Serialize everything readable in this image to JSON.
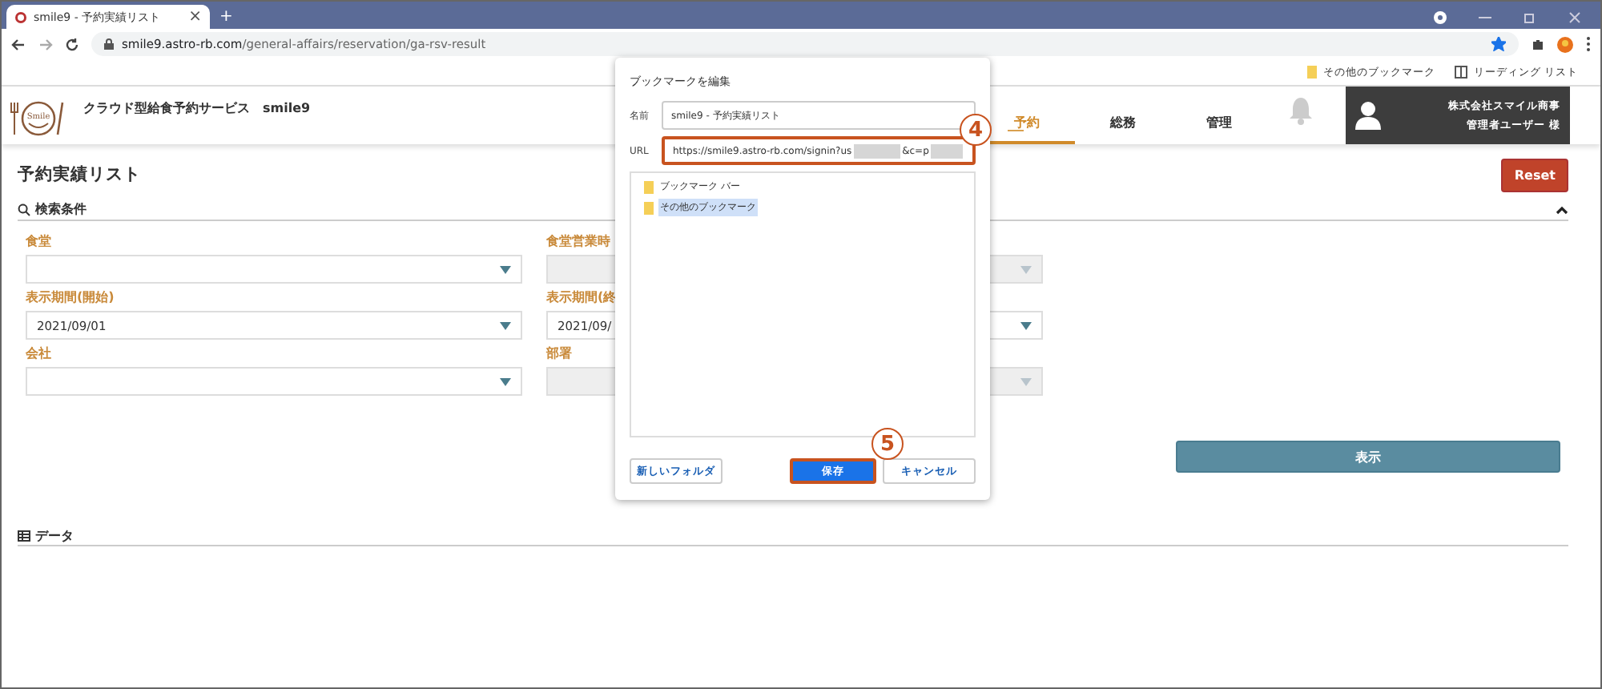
{
  "browser": {
    "tab_title": "smile9 - 予約実績リスト",
    "tab_close": "×",
    "new_tab": "+",
    "host": "smile9.astro-rb.com",
    "path": "/general-affairs/reservation/ga-rsv-result",
    "bookmarked": true,
    "bookmarks": [
      {
        "label": "その他のブックマーク",
        "kind": "folder"
      },
      {
        "label": "リーディング リスト",
        "kind": "reading"
      }
    ]
  },
  "app": {
    "logo_text": "Smile",
    "service_name": "クラウド型給食予約サービス　smile9",
    "nav": [
      {
        "label": "予約",
        "selected": true
      },
      {
        "label": "総務",
        "selected": false
      },
      {
        "label": "管理",
        "selected": false
      }
    ],
    "user": {
      "company": "株式会社スマイル商事",
      "name": "管理者ユーザー 様"
    }
  },
  "page": {
    "title": "予約実績リスト",
    "reset_button": "Reset",
    "search_title": "検索条件",
    "search_expanded": true,
    "fields": [
      {
        "label": "食堂",
        "disabled": false
      },
      {
        "label": "食堂営業時",
        "disabled": true
      },
      {
        "label": "表示期間(開始)",
        "value": "2021/09/01",
        "disabled": false
      },
      {
        "label": "表示期間(終",
        "value": "2021/09/",
        "disabled": false
      },
      {
        "label": "会社",
        "disabled": false
      },
      {
        "label": "部署",
        "disabled": true
      }
    ],
    "show_button": "表示",
    "data_title": "データ"
  },
  "dialog": {
    "title": "ブックマークを編集",
    "name_label": "名前",
    "name_value": "smile9 - 予約実績リスト",
    "url_label": "URL",
    "url_parts": [
      "https://smile9.astro-rb.com/signin?us",
      "&c=p"
    ],
    "url_annotation": "4",
    "folders": [
      {
        "label": "ブックマーク バー",
        "selected": false
      },
      {
        "label": "その他のブックマーク",
        "selected": true
      }
    ],
    "buttons": [
      {
        "label": "新しいフォルダ",
        "kind": "secondary"
      },
      {
        "label": "保存",
        "kind": "primary",
        "annotation": "5"
      },
      {
        "label": "キャンセル",
        "kind": "secondary"
      }
    ]
  }
}
